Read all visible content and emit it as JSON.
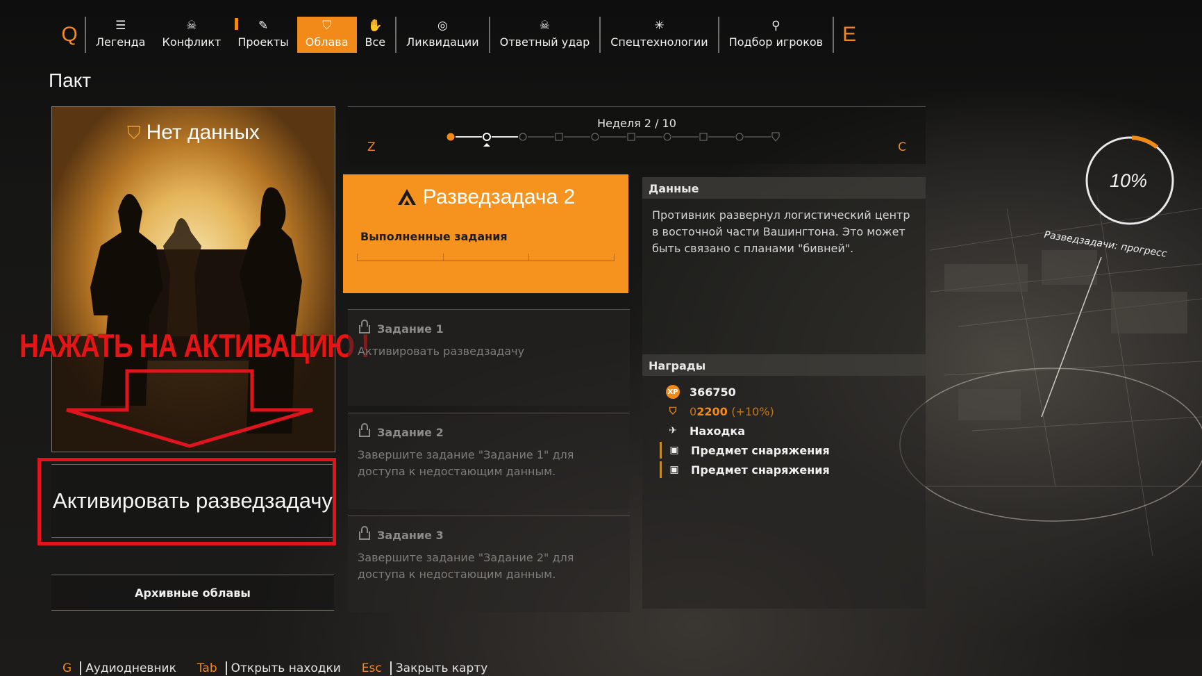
{
  "nav": {
    "left_key": "Q",
    "right_key": "E",
    "tabs": [
      {
        "label": "Легенда",
        "icon": "list-icon",
        "glyph": "☰"
      },
      {
        "label": "Конфликт",
        "icon": "skull-icon",
        "glyph": "☠"
      },
      {
        "label": "Проекты",
        "icon": "clipboard-icon",
        "glyph": "✎"
      },
      {
        "label": "Облава",
        "icon": "shield-pin-icon",
        "glyph": "⛉"
      },
      {
        "label": "Все",
        "icon": "hand-icon",
        "glyph": "✋"
      },
      {
        "label": "Ликвидации",
        "icon": "target-icon",
        "glyph": "◎"
      },
      {
        "label": "Ответный удар",
        "icon": "skull-wings-icon",
        "glyph": "☠"
      },
      {
        "label": "Спецтехнологии",
        "icon": "spark-icon",
        "glyph": "✳"
      },
      {
        "label": "Подбор игроков",
        "icon": "add-player-icon",
        "glyph": "⚲"
      }
    ],
    "active_tab": "Облава"
  },
  "page": {
    "title": "Пакт"
  },
  "hero": {
    "title": "Нет данных"
  },
  "overlay": {
    "instruction": "НАЖАТЬ НА АКТИВАЦИЮ !"
  },
  "buttons": {
    "activate": "Активировать разведзадачу",
    "archive": "Архивные облавы"
  },
  "week": {
    "label": "Неделя 2 / 10",
    "prev_key": "Z",
    "next_key": "C",
    "total": 10,
    "current": 2
  },
  "mission": {
    "title": "Разведзадача 2",
    "subtitle": "Выполненные задания"
  },
  "tasks": [
    {
      "title": "Задание 1",
      "desc": "Активировать разведзадачу"
    },
    {
      "title": "Задание 2",
      "desc": "Завершите задание \"Задание 1\" для доступа к недостающим данным."
    },
    {
      "title": "Задание 3",
      "desc": "Завершите задание \"Задание 2\" для доступа к недостающим данным."
    }
  ],
  "data_panel": {
    "header": "Данные",
    "text": "Противник развернул логистический центр в восточной части Вашингтона. Это может быть связано с планами \"бивней\"."
  },
  "rewards": {
    "header": "Награды",
    "xp_icon_text": "XP",
    "xp": "366750",
    "currency_prefix": "0",
    "currency": "2200",
    "currency_bonus": "(+10%)",
    "find": "Находка",
    "gear_1": "Предмет снаряжения",
    "gear_2": "Предмет снаряжения"
  },
  "progress": {
    "percent_text": "10%",
    "value": 0.1,
    "label": "Разведзадачи: прогресс"
  },
  "hints": [
    {
      "key": "G",
      "label": "Аудиодневник"
    },
    {
      "key": "Tab",
      "label": "Открыть находки"
    },
    {
      "key": "Esc",
      "label": "Закрыть карту"
    }
  ],
  "colors": {
    "accent": "#f28a19",
    "annotation_red": "#e0141c"
  }
}
